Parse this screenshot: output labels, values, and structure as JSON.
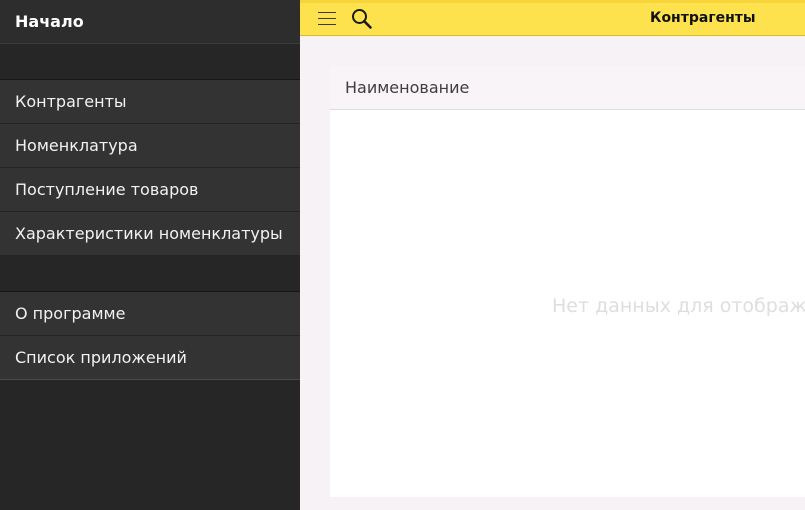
{
  "drawer": {
    "header": "Начало",
    "group1": [
      "Контрагенты",
      "Номенклатура",
      "Поступление товаров",
      "Характеристики номенклатуры"
    ],
    "group2": [
      "О программе",
      "Список приложений"
    ]
  },
  "toolbar": {
    "title": "Контрагенты",
    "menu_icon": "hamburger-menu-icon",
    "search_icon": "search-icon"
  },
  "list": {
    "column_header": "Наименование",
    "empty_text": "Нет данных для отображения"
  },
  "colors": {
    "toolbar": "#fde24e",
    "drawer": "#262626",
    "drawer_item": "#333333",
    "background": "#f6f2f6"
  }
}
